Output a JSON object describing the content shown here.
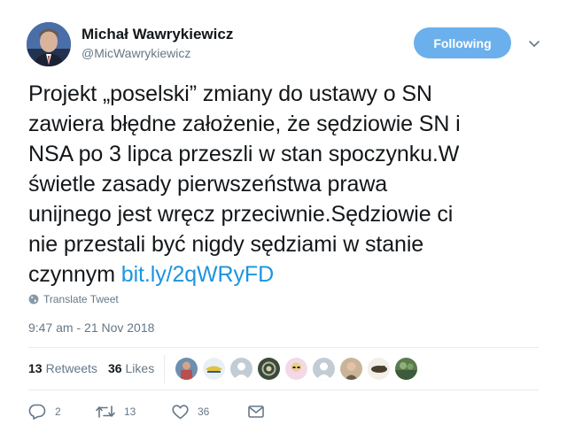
{
  "author": {
    "name": "Michał Wawrykiewicz",
    "handle": "@MicWawrykiewicz"
  },
  "follow_button": {
    "label": "Following"
  },
  "tweet": {
    "line1": "Projekt „poselski” zmiany do ustawy o SN",
    "line2": "zawiera błędne założenie, że sędziowie SN i",
    "line3": "NSA po 3 lipca przeszli w stan spoczynku.W",
    "line4": "świetle zasady pierwszeństwa prawa",
    "line5": "unijnego jest wręcz przeciwnie.Sędziowie ci",
    "line6": "nie przestali być nigdy sędziami w stanie",
    "line7_text": "czynnym",
    "link": "bit.ly/2qWRyFD"
  },
  "translate_label": "Translate Tweet",
  "timestamp": "9:47 am - 21 Nov 2018",
  "stats": {
    "retweets_count": "13",
    "retweets_label": "Retweets",
    "likes_count": "36",
    "likes_label": "Likes"
  },
  "actions": {
    "reply_count": "2",
    "retweet_count": "13",
    "like_count": "36"
  },
  "colors": {
    "accent": "#1b95e0",
    "follow_bg": "#6bb0ec",
    "muted": "#657786",
    "text": "#14171a"
  },
  "icons": [
    "chevron-down-icon",
    "globe-icon",
    "reply-icon",
    "retweet-icon",
    "heart-icon",
    "mail-icon"
  ]
}
